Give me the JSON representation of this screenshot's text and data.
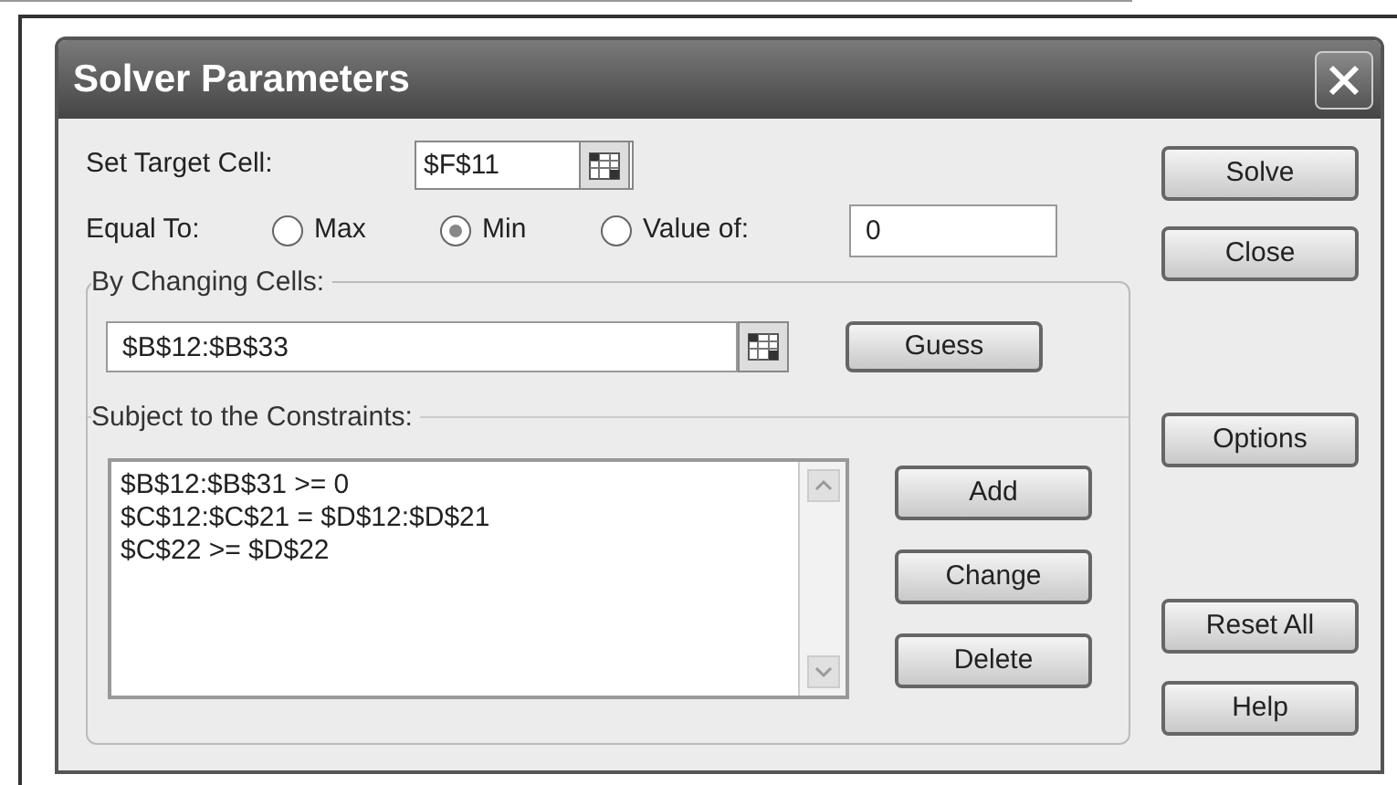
{
  "window": {
    "title": "Solver Parameters"
  },
  "target_cell": {
    "label": "Set Target Cell:",
    "value": "$F$11"
  },
  "equal_to": {
    "label": "Equal To:",
    "options": [
      {
        "label": "Max",
        "selected": false
      },
      {
        "label": "Min",
        "selected": true
      },
      {
        "label": "Value of:",
        "selected": false
      }
    ],
    "value": "0"
  },
  "changing_cells": {
    "label": "By Changing Cells:",
    "value": "$B$12:$B$33",
    "button": {
      "label": "Guess"
    }
  },
  "constraints": {
    "label": "Subject to the Constraints:",
    "items": [
      "$B$12:$B$31 >= 0",
      "$C$12:$C$21 = $D$12:$D$21",
      "$C$22 >= $D$22"
    ],
    "buttons": [
      {
        "label": "Add"
      },
      {
        "label": "Change"
      },
      {
        "label": "Delete"
      }
    ]
  },
  "side_buttons": [
    {
      "label": "Solve"
    },
    {
      "label": "Close"
    },
    {
      "label": "Options"
    },
    {
      "label": "Reset All"
    },
    {
      "label": "Help"
    }
  ]
}
